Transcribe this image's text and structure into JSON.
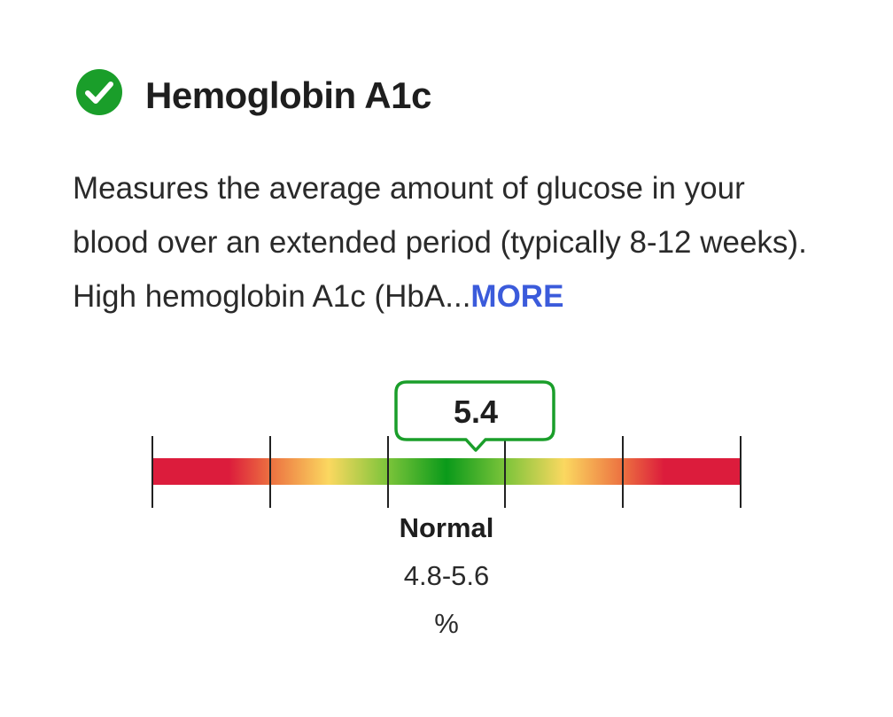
{
  "test": {
    "status_icon": "check-circle-icon",
    "status_color": "#1a9e2a",
    "name": "Hemoglobin A1c",
    "description": "Measures the average amount of glucose in your blood over an extended period (typically 8-12 weeks). High hemoglobin A1c (HbA...",
    "more_label": "MORE",
    "more_color": "#3b5bdb"
  },
  "result": {
    "value": "5.4",
    "value_number": 5.4,
    "range_name": "Normal",
    "range_values": "4.8-5.6",
    "unit": "%",
    "marker_color": "#1a9e2a"
  },
  "gauge_colors": {
    "out_of_range": "#dc1c3c",
    "borderline": "#f0d04a",
    "optimal": "#0a9a1a"
  }
}
